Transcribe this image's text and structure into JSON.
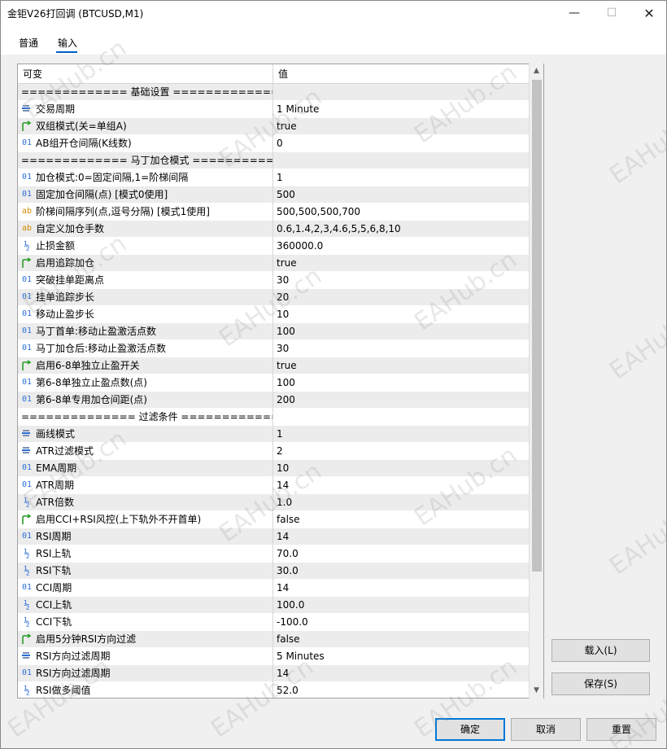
{
  "window": {
    "title": "金钜V26打回调 (BTCUSD,M1)",
    "minimize": "—",
    "maximize": "☐",
    "close": "✕"
  },
  "tabs": [
    {
      "label": "普通",
      "active": false
    },
    {
      "label": "输入",
      "active": true
    }
  ],
  "grid": {
    "header": {
      "name": "可变",
      "value": "值"
    },
    "rows": [
      {
        "icon": "none",
        "name": "============= 基础设置 ===============",
        "value": ""
      },
      {
        "icon": "enum-icon",
        "name": "交易周期",
        "value": "1 Minute"
      },
      {
        "icon": "bool-icon",
        "name": "双组模式(关=单组A)",
        "value": "true"
      },
      {
        "icon": "int-icon",
        "name": "AB组开仓间隔(K线数)",
        "value": "0"
      },
      {
        "icon": "none",
        "name": "============= 马丁加仓模式 ============",
        "value": ""
      },
      {
        "icon": "int-icon",
        "name": "加仓模式:0=固定间隔,1=阶梯间隔",
        "value": "1"
      },
      {
        "icon": "int-icon",
        "name": "固定加仓间隔(点) [模式0使用]",
        "value": "500"
      },
      {
        "icon": "string-icon",
        "name": "阶梯间隔序列(点,逗号分隔) [模式1使用]",
        "value": "500,500,500,700"
      },
      {
        "icon": "string-icon",
        "name": "自定义加仓手数",
        "value": "0.6,1.4,2,3,4.6,5,5,6,8,10"
      },
      {
        "icon": "double-icon",
        "name": "止损金额",
        "value": "360000.0"
      },
      {
        "icon": "bool-icon",
        "name": "启用追踪加仓",
        "value": "true"
      },
      {
        "icon": "int-icon",
        "name": "突破挂单距离点",
        "value": "30"
      },
      {
        "icon": "int-icon",
        "name": "挂单追踪步长",
        "value": "20"
      },
      {
        "icon": "int-icon",
        "name": "移动止盈步长",
        "value": "10"
      },
      {
        "icon": "int-icon",
        "name": "马丁首单:移动止盈激活点数",
        "value": "100"
      },
      {
        "icon": "int-icon",
        "name": "马丁加仓后:移动止盈激活点数",
        "value": "30"
      },
      {
        "icon": "bool-icon",
        "name": "启用6-8单独立止盈开关",
        "value": "true"
      },
      {
        "icon": "int-icon",
        "name": "第6-8单独立止盈点数(点)",
        "value": "100"
      },
      {
        "icon": "int-icon",
        "name": "第6-8单专用加仓间距(点)",
        "value": "200"
      },
      {
        "icon": "none",
        "name": "============== 过滤条件 ===============",
        "value": ""
      },
      {
        "icon": "enum-icon",
        "name": "画线模式",
        "value": "1"
      },
      {
        "icon": "enum-icon",
        "name": "ATR过滤模式",
        "value": "2"
      },
      {
        "icon": "int-icon",
        "name": "EMA周期",
        "value": "10"
      },
      {
        "icon": "int-icon",
        "name": "ATR周期",
        "value": "14"
      },
      {
        "icon": "double-icon",
        "name": "ATR倍数",
        "value": "1.0"
      },
      {
        "icon": "bool-icon",
        "name": "启用CCI+RSI风控(上下轨外不开首单)",
        "value": "false"
      },
      {
        "icon": "int-icon",
        "name": "RSI周期",
        "value": "14"
      },
      {
        "icon": "double-icon",
        "name": "RSI上轨",
        "value": "70.0"
      },
      {
        "icon": "double-icon",
        "name": "RSI下轨",
        "value": "30.0"
      },
      {
        "icon": "int-icon",
        "name": "CCI周期",
        "value": "14"
      },
      {
        "icon": "double-icon",
        "name": "CCI上轨",
        "value": "100.0"
      },
      {
        "icon": "double-icon",
        "name": "CCI下轨",
        "value": "-100.0"
      },
      {
        "icon": "bool-icon",
        "name": "启用5分钟RSI方向过滤",
        "value": "false"
      },
      {
        "icon": "enum-icon",
        "name": "RSI方向过滤周期",
        "value": "5 Minutes"
      },
      {
        "icon": "int-icon",
        "name": "RSI方向过滤周期",
        "value": "14"
      },
      {
        "icon": "double-icon",
        "name": "RSI做多阈值",
        "value": "52.0"
      }
    ]
  },
  "buttons": {
    "load": "载入(L)",
    "save": "保存(S)",
    "ok": "确定",
    "cancel": "取消",
    "reset": "重置"
  },
  "icon_glyphs": {
    "int-icon": "01",
    "string-icon": "ab",
    "double-icon": "½"
  },
  "watermark": "EAHub.cn"
}
